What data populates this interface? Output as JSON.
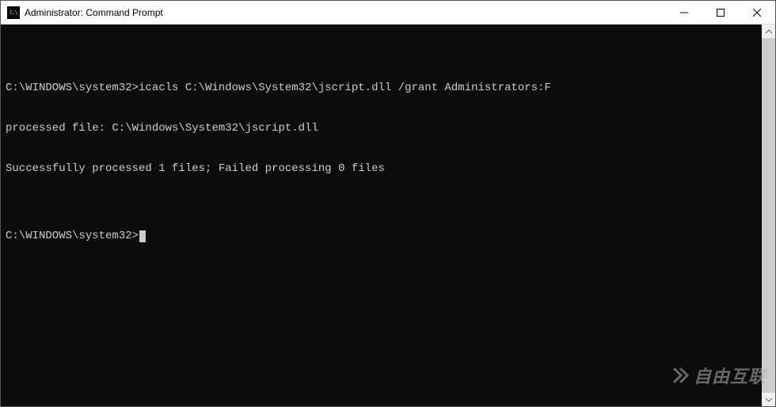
{
  "titlebar": {
    "icon_label": "C:\\",
    "title": "Administrator: Command Prompt"
  },
  "terminal": {
    "lines": [
      "",
      "C:\\WINDOWS\\system32>icacls C:\\Windows\\System32\\jscript.dll /grant Administrators:F",
      "processed file: C:\\Windows\\System32\\jscript.dll",
      "Successfully processed 1 files; Failed processing 0 files",
      "",
      "C:\\WINDOWS\\system32>"
    ]
  },
  "watermark": {
    "text": "自由互联"
  }
}
